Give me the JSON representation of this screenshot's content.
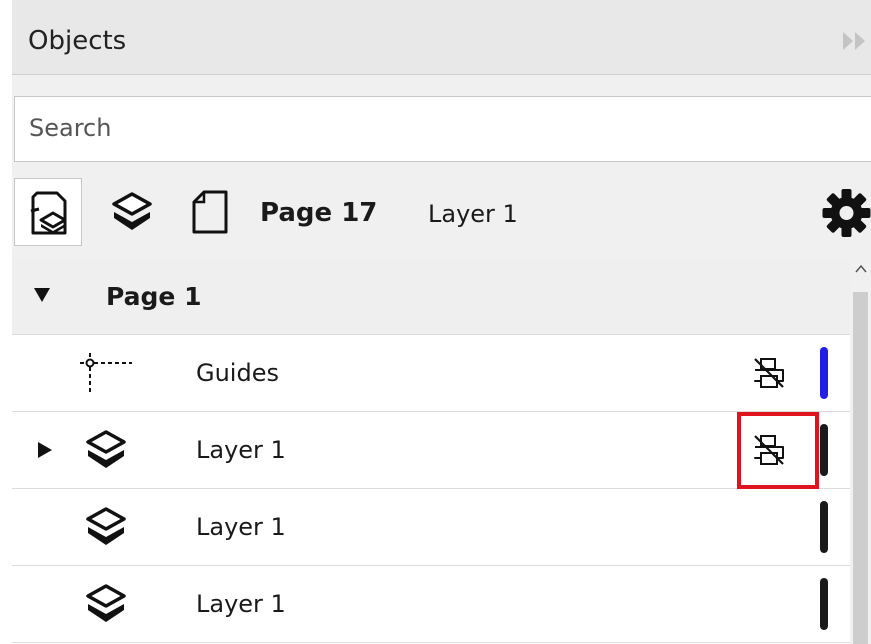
{
  "panel": {
    "title": "Objects"
  },
  "search": {
    "placeholder": "Search",
    "value": ""
  },
  "toolbar": {
    "buttons": [
      {
        "icon": "page-layers-icon",
        "active": true
      },
      {
        "icon": "layers-icon",
        "active": false
      },
      {
        "icon": "page-icon",
        "active": false
      }
    ],
    "current_page": "Page 17",
    "current_layer": "Layer 1",
    "settings_icon": "gear-icon"
  },
  "tree": {
    "page": {
      "label": "Page 1",
      "expanded": true
    },
    "rows": [
      {
        "label": "Guides",
        "icon": "guides-icon",
        "printable_icon": "print-disabled-icon",
        "color": "#1f1fe6"
      },
      {
        "label": "Layer 1",
        "icon": "layer-icon",
        "printable_icon": "print-disabled-icon",
        "color": "#1a1a1a",
        "collapsed": true,
        "highlighted": true
      },
      {
        "label": "Layer 1",
        "icon": "layer-icon",
        "color": "#1a1a1a"
      },
      {
        "label": "Layer 1",
        "icon": "layer-icon",
        "color": "#1a1a1a"
      }
    ]
  },
  "colors": {
    "highlight": "#e0141e",
    "guides": "#1f1fe6",
    "layer": "#1a1a1a"
  }
}
